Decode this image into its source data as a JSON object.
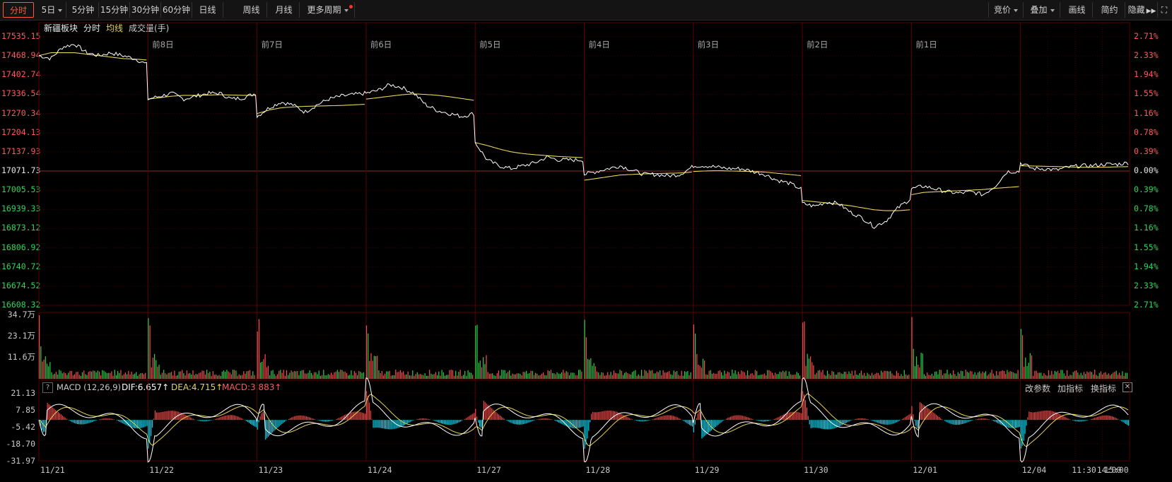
{
  "toolbar": {
    "periods": [
      "分时",
      "5日",
      "5分钟",
      "15分钟",
      "30分钟",
      "60分钟",
      "日线",
      "周线",
      "月线",
      "更多周期"
    ],
    "right_buttons": [
      "竞价",
      "叠加",
      "画线",
      "简约",
      "隐藏"
    ]
  },
  "main_chart": {
    "security": "新疆板块",
    "mode": "分时",
    "avg_label": "均线",
    "vol_label": "成交量(手)",
    "day_labels": [
      "前8日",
      "前7日",
      "前6日",
      "前5日",
      "前4日",
      "前3日",
      "前2日",
      "前1日"
    ],
    "y_left": [
      "17535.15",
      "17468.94",
      "17402.74",
      "17336.54",
      "17270.34",
      "17204.13",
      "17137.93",
      "17071.73",
      "17005.53",
      "16939.33",
      "16873.12",
      "16806.92",
      "16740.72",
      "16674.52",
      "16608.32"
    ],
    "y_right": [
      "2.71%",
      "2.33%",
      "1.94%",
      "1.55%",
      "1.16%",
      "0.78%",
      "0.39%",
      "0.00%",
      "0.39%",
      "0.78%",
      "1.16%",
      "1.55%",
      "1.94%",
      "2.33%",
      "2.71%"
    ]
  },
  "volume_chart": {
    "y_labels": [
      "34.7万",
      "23.1万",
      "11.6万"
    ]
  },
  "macd": {
    "help": "?",
    "title": "MACD (12,26,9)",
    "dif": "DIF:6.657↑",
    "dea": "DEA:4.715↑",
    "macd": "MACD:3.883↑",
    "buttons": [
      "改参数",
      "加指标",
      "换指标"
    ],
    "y_labels": [
      "21.13",
      "7.85",
      "-5.42",
      "-18.70",
      "-31.97"
    ]
  },
  "x_labels": [
    "11/21",
    "11/22",
    "11/23",
    "11/24",
    "11/27",
    "11/28",
    "11/29",
    "11/30",
    "12/01",
    "12/04",
    "11:30",
    "14:00",
    "15:00"
  ],
  "colors": {
    "up": "#ff4d4d",
    "down": "#2fd04a",
    "macd_down": "#00e5ff",
    "price": "#ffffff",
    "avg": "#e6d35a",
    "grid": "#3a0000"
  },
  "chart_data": {
    "type": "line",
    "title": "新疆板块",
    "base_value": 17071.73,
    "ylim": [
      16608.32,
      17535.15
    ],
    "days": [
      "11/21",
      "11/22",
      "11/23",
      "11/24",
      "11/27",
      "11/28",
      "11/29",
      "11/30",
      "12/01",
      "12/04"
    ],
    "series": [
      {
        "name": "分时",
        "values": [
          [
            17470,
            17460,
            17500,
            17510,
            17480,
            17470,
            17480,
            17470,
            17460,
            17440
          ],
          [
            17320,
            17330,
            17340,
            17320,
            17330,
            17340,
            17340,
            17320,
            17325,
            17340
          ],
          [
            17260,
            17290,
            17310,
            17300,
            17275,
            17300,
            17320,
            17330,
            17335,
            17340
          ],
          [
            17340,
            17350,
            17370,
            17360,
            17340,
            17300,
            17280,
            17270,
            17260,
            17270
          ],
          [
            17170,
            17110,
            17090,
            17080,
            17090,
            17100,
            17120,
            17110,
            17110,
            17110
          ],
          [
            17060,
            17070,
            17080,
            17090,
            17075,
            17060,
            17060,
            17055,
            17060,
            17085
          ],
          [
            17090,
            17090,
            17085,
            17080,
            17080,
            17070,
            17060,
            17040,
            17030,
            17010
          ],
          [
            16960,
            16950,
            16965,
            16960,
            16930,
            16910,
            16880,
            16900,
            16945,
            16975
          ],
          [
            17010,
            17020,
            17010,
            17000,
            16995,
            17000,
            16990,
            17020,
            17070,
            17070
          ],
          [
            17100,
            17080,
            17080,
            17075,
            17085,
            17090,
            17090,
            17095,
            17095,
            17100
          ]
        ]
      },
      {
        "name": "均线",
        "values": [
          [
            17470,
            17480,
            17480,
            17480,
            17475,
            17470,
            17465,
            17460,
            17458,
            17455
          ],
          [
            17320,
            17325,
            17330,
            17333,
            17333,
            17334,
            17335,
            17334,
            17333,
            17333
          ],
          [
            17270,
            17282,
            17290,
            17293,
            17295,
            17296,
            17297,
            17298,
            17300,
            17302
          ],
          [
            17320,
            17325,
            17330,
            17335,
            17338,
            17336,
            17333,
            17328,
            17322,
            17316
          ],
          [
            17170,
            17160,
            17148,
            17138,
            17132,
            17128,
            17125,
            17122,
            17120,
            17118
          ],
          [
            17040,
            17046,
            17052,
            17058,
            17060,
            17062,
            17063,
            17064,
            17065,
            17068
          ],
          [
            17070,
            17072,
            17073,
            17072,
            17071,
            17070,
            17068,
            17064,
            17060,
            17056
          ],
          [
            16970,
            16966,
            16962,
            16957,
            16952,
            16945,
            16938,
            16935,
            16935,
            16938
          ],
          [
            16990,
            16998,
            17000,
            17002,
            17004,
            17006,
            17008,
            17012,
            17015,
            17018
          ],
          [
            17090,
            17089,
            17088,
            17087,
            17086,
            17085,
            17085,
            17085,
            17086,
            17087
          ]
        ]
      }
    ],
    "volume": {
      "name": "成交量(手)",
      "peak_labels": [
        "34.7万",
        "23.1万",
        "11.6万"
      ]
    },
    "macd": {
      "params": "12,26,9",
      "dif": 6.657,
      "dea": 4.715,
      "macd": 3.883,
      "ylim": [
        -31.97,
        21.13
      ]
    }
  }
}
